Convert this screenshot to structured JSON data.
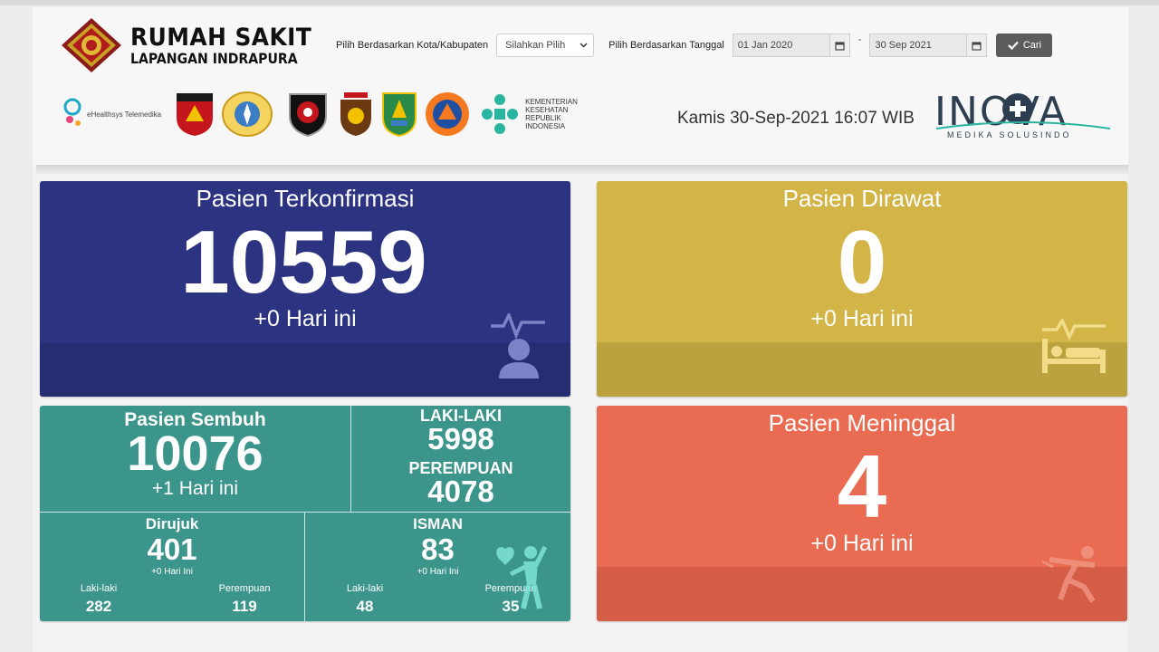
{
  "header": {
    "brand_title": "RUMAH SAKIT",
    "brand_subtitle": "LAPANGAN INDRAPURA",
    "filter_city_label": "Pilih Berdasarkan Kota/Kabupaten",
    "filter_city_value": "Silahkan Pilih",
    "filter_date_label": "Pilih Berdasarkan Tanggal",
    "date_from": "01 Jan 2020",
    "date_separator": "-",
    "date_to": "30 Sep 2021",
    "search_button": "Cari",
    "ehealth_label": "eHealthsys Telemedika",
    "kemenkes_label": [
      "KEMENTERIAN",
      "KESEHATAN",
      "REPUBLIK",
      "INDONESIA"
    ],
    "datetime": "Kamis 30-Sep-2021 16:07 WIB",
    "inova_title": "INOVA",
    "inova_subtitle": "MEDIKA SOLUSINDO"
  },
  "confirmed": {
    "title": "Pasien Terkonfirmasi",
    "value": "10559",
    "today": "+0 Hari ini",
    "icon": "patient-monitor-icon",
    "color": "#2c3381"
  },
  "treated": {
    "title": "Pasien Dirawat",
    "value": "0",
    "today": "+0 Hari ini",
    "icon": "hospital-bed-icon",
    "color": "#d2b447"
  },
  "recovered": {
    "title": "Pasien Sembuh",
    "value": "10076",
    "today": "+1 Hari ini",
    "color": "#3b958b",
    "male_label": "LAKI-LAKI",
    "male_value": "5998",
    "female_label": "PEREMPUAN",
    "female_value": "4078",
    "referred": {
      "title": "Dirujuk",
      "value": "401",
      "today": "+0 Hari Ini",
      "male_label": "Laki-laki",
      "male_value": "282",
      "female_label": "Perempuan",
      "female_value": "119"
    },
    "isman": {
      "title": "ISMAN",
      "value": "83",
      "today": "+0 Hari Ini",
      "male_label": "Laki-laki",
      "male_value": "48",
      "female_label": "Perempuan",
      "female_value": "35"
    },
    "icon": "healthy-person-icon"
  },
  "deceased": {
    "title": "Pasien Meninggal",
    "value": "4",
    "today": "+0 Hari ini",
    "icon": "falling-person-icon",
    "color": "#e86b52"
  }
}
